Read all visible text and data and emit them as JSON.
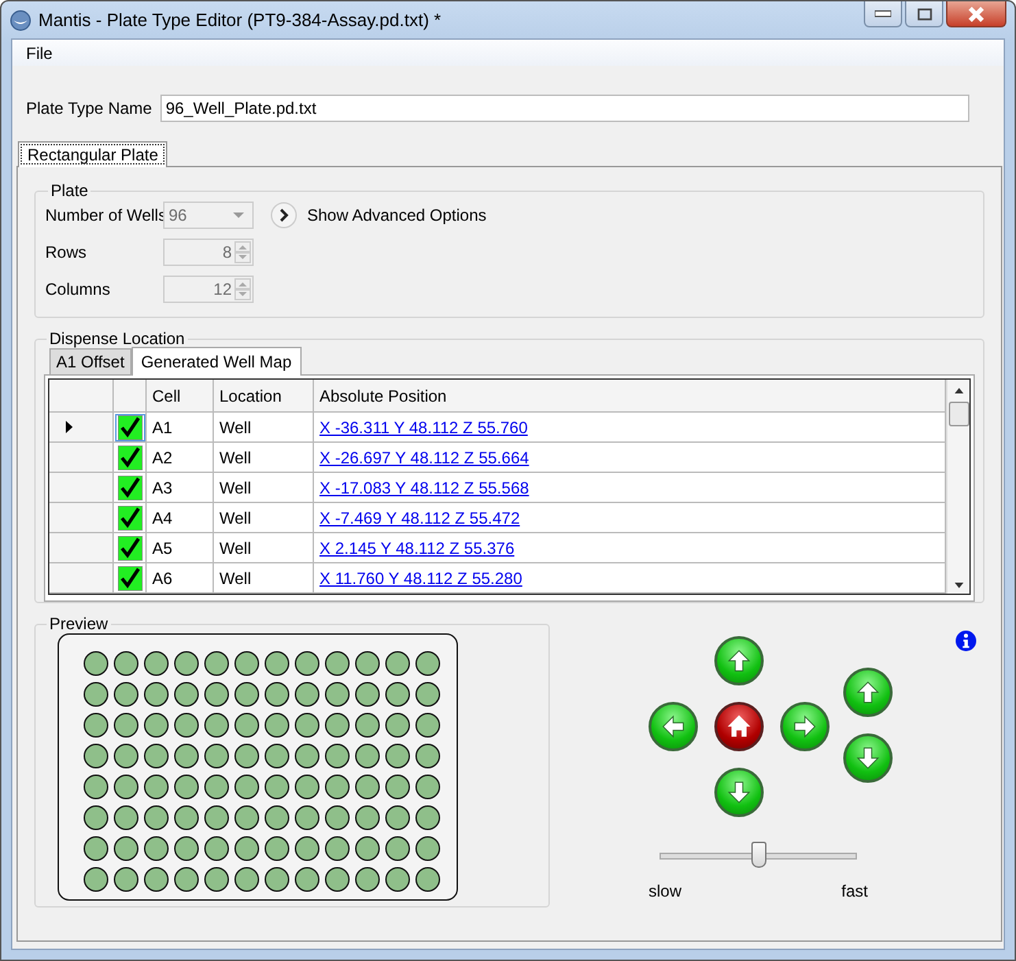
{
  "window": {
    "title": "Mantis - Plate Type Editor (PT9-384-Assay.pd.txt) *"
  },
  "menu": [
    "File"
  ],
  "plate_type_name": {
    "label": "Plate Type Name",
    "value": "96_Well_Plate.pd.txt"
  },
  "tabs": [
    {
      "label": "Rectangular Plate",
      "selected": true
    }
  ],
  "plate": {
    "title": "Plate",
    "fields": [
      {
        "kind": "dropdown",
        "label": "Number of Wells",
        "value": "96",
        "disabled": true
      },
      {
        "kind": "spinner",
        "label": "Rows",
        "value": "8",
        "disabled": true
      },
      {
        "kind": "spinner",
        "label": "Columns",
        "value": "12",
        "disabled": true
      }
    ],
    "advanced_button": "Show Advanced Options"
  },
  "dispense_location": {
    "title": "Dispense Location",
    "tabs": [
      {
        "label": "A1 Offset",
        "selected": false
      },
      {
        "label": "Generated Well Map",
        "selected": true
      }
    ],
    "table": {
      "columns": [
        "Cell",
        "Location",
        "Absolute Position"
      ],
      "rows": [
        {
          "current": true,
          "checked": true,
          "cell": "A1",
          "location": "Well",
          "position": "X -36.311 Y 48.112 Z 55.760"
        },
        {
          "current": false,
          "checked": true,
          "cell": "A2",
          "location": "Well",
          "position": "X -26.697 Y 48.112 Z 55.664"
        },
        {
          "current": false,
          "checked": true,
          "cell": "A3",
          "location": "Well",
          "position": "X -17.083 Y 48.112 Z 55.568"
        },
        {
          "current": false,
          "checked": true,
          "cell": "A4",
          "location": "Well",
          "position": "X -7.469 Y 48.112 Z 55.472"
        },
        {
          "current": false,
          "checked": true,
          "cell": "A5",
          "location": "Well",
          "position": "X 2.145 Y 48.112 Z 55.376"
        },
        {
          "current": false,
          "checked": true,
          "cell": "A6",
          "location": "Well",
          "position": "X 11.760 Y 48.112 Z 55.280"
        }
      ]
    }
  },
  "preview": {
    "title": "Preview"
  },
  "speed": {
    "level": 0.5,
    "min_label": "slow",
    "max_label": "fast"
  }
}
